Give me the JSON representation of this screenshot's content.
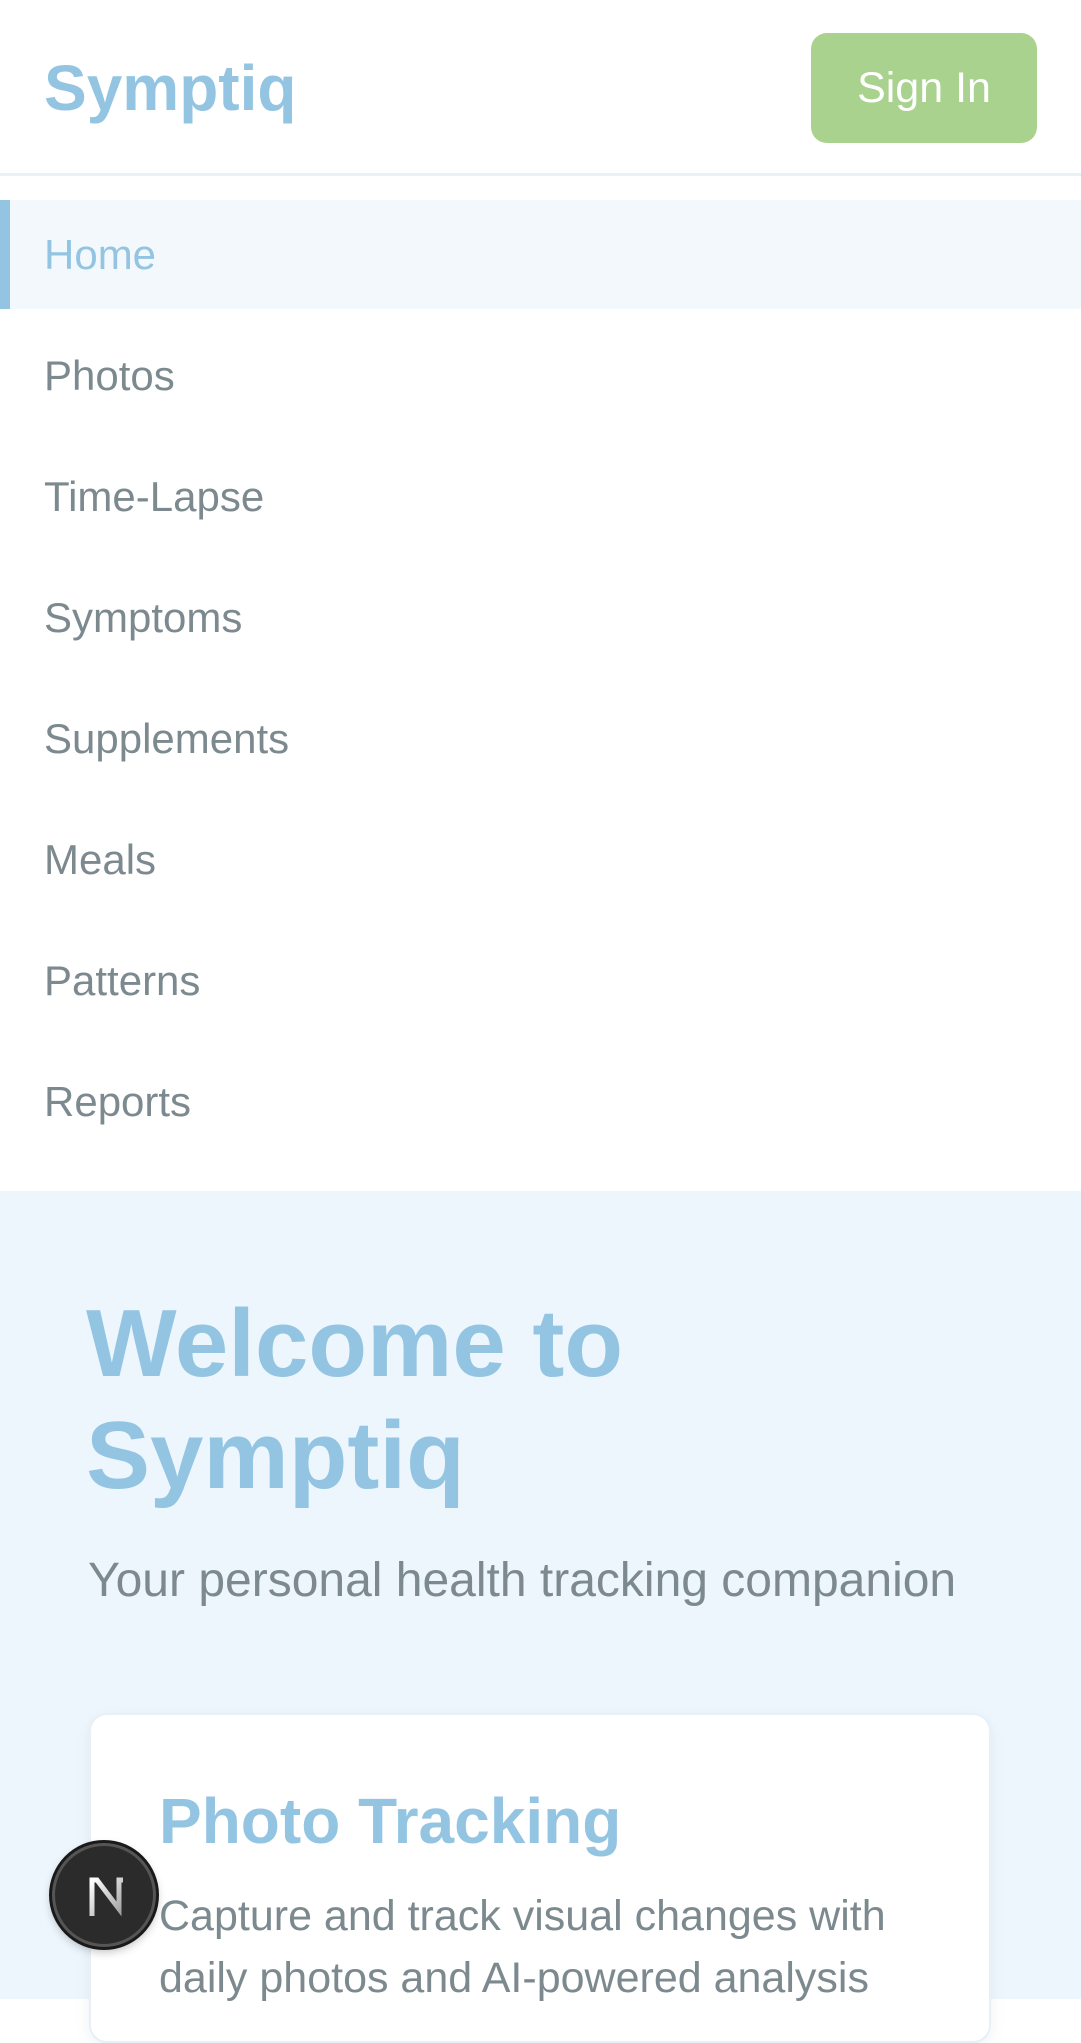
{
  "header": {
    "logo": "Symptiq",
    "sign_in_label": "Sign In"
  },
  "nav": {
    "items": [
      {
        "label": "Home",
        "active": true
      },
      {
        "label": "Photos"
      },
      {
        "label": "Time-Lapse"
      },
      {
        "label": "Symptoms"
      },
      {
        "label": "Supplements"
      },
      {
        "label": "Meals"
      },
      {
        "label": "Patterns"
      },
      {
        "label": "Reports"
      }
    ]
  },
  "hero": {
    "title": "Welcome to Symptiq",
    "subtitle": "Your personal health tracking companion"
  },
  "cards": [
    {
      "title": "Photo Tracking",
      "description": "Capture and track visual changes with daily photos and AI-powered analysis"
    }
  ],
  "devtools": {
    "icon": "nextjs-logo-icon"
  },
  "colors": {
    "brand": "#93c5e2",
    "sign_in_button": "#a8d28d",
    "text_muted": "#7c8a8f",
    "main_background": "#eef6fd",
    "active_nav_background": "#f2f8fc"
  }
}
